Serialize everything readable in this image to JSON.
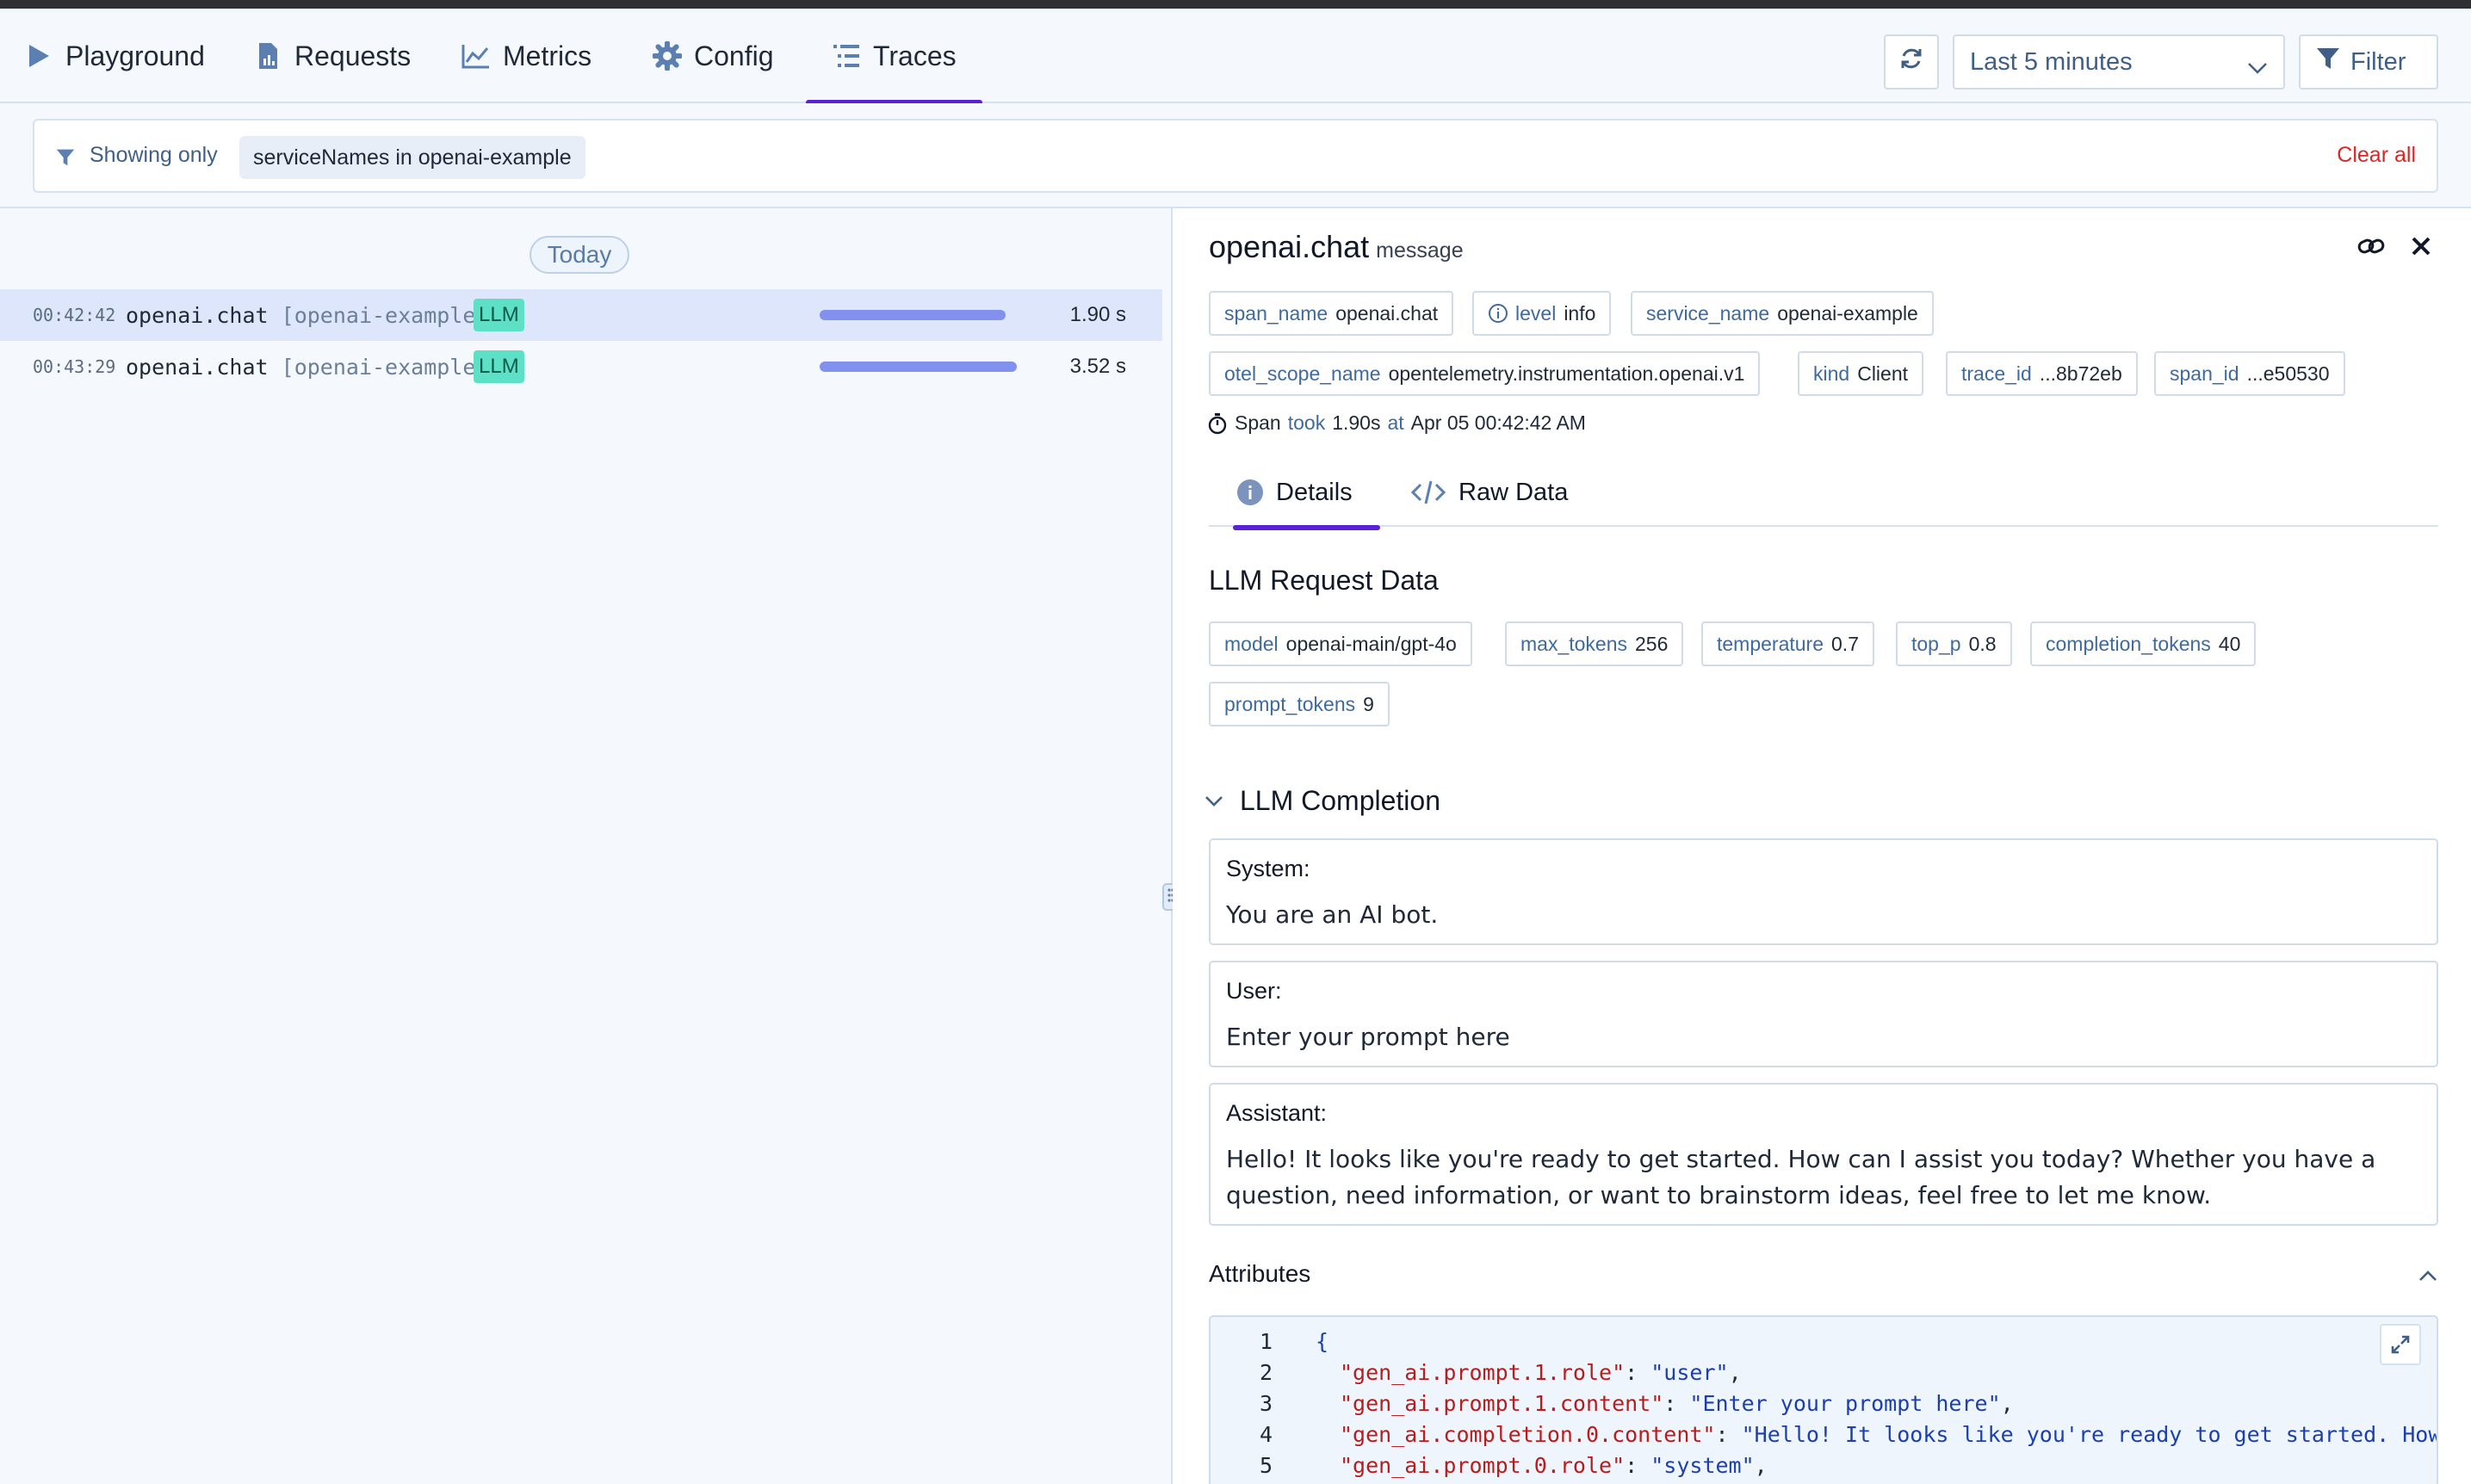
{
  "nav": {
    "tabs": [
      {
        "label": "Playground",
        "icon": "play-icon"
      },
      {
        "label": "Requests",
        "icon": "report-icon"
      },
      {
        "label": "Metrics",
        "icon": "chart-line-icon"
      },
      {
        "label": "Config",
        "icon": "gear-icon"
      },
      {
        "label": "Traces",
        "icon": "list-tree-icon",
        "active": true
      }
    ],
    "time_range": "Last 5 minutes",
    "filter_label": "Filter",
    "accent": "#5b21d6"
  },
  "filter_bar": {
    "label": "Showing only",
    "chip": "serviceNames in openai-example",
    "clear": "Clear all"
  },
  "traces": {
    "group_label": "Today",
    "rows": [
      {
        "time": "00:42:42",
        "name": "openai.chat",
        "service": "[openai-example]",
        "badge": "LLM",
        "duration": "1.90 s",
        "duration_fraction": 0.49,
        "selected": true
      },
      {
        "time": "00:43:29",
        "name": "openai.chat",
        "service": "[openai-example]",
        "badge": "LLM",
        "duration": "3.52 s",
        "duration_fraction": 0.52,
        "selected": false
      }
    ]
  },
  "detail": {
    "title": "openai.chat",
    "kind": "message",
    "tags_row1": [
      {
        "k": "span_name",
        "v": "openai.chat"
      },
      {
        "k": "level",
        "v": "info",
        "icon": "info-icon"
      },
      {
        "k": "service_name",
        "v": "openai-example"
      }
    ],
    "tags_row2": [
      {
        "k": "otel_scope_name",
        "v": "opentelemetry.instrumentation.openai.v1"
      },
      {
        "k": "kind",
        "v": "Client"
      },
      {
        "k": "trace_id",
        "v": "...8b72eb"
      },
      {
        "k": "span_id",
        "v": "...e50530"
      }
    ],
    "took": {
      "prefix": "Span",
      "took_word": "took",
      "value": "1.90s",
      "at_word": "at",
      "when": "Apr 05 00:42:42 AM"
    },
    "tabs": [
      {
        "label": "Details",
        "active": true
      },
      {
        "label": "Raw Data"
      }
    ],
    "request_heading": "LLM Request Data",
    "request_tags_row1": [
      {
        "k": "model",
        "v": "openai-main/gpt-4o"
      },
      {
        "k": "max_tokens",
        "v": "256"
      },
      {
        "k": "temperature",
        "v": "0.7"
      },
      {
        "k": "top_p",
        "v": "0.8"
      },
      {
        "k": "completion_tokens",
        "v": "40"
      }
    ],
    "request_tags_row2": [
      {
        "k": "prompt_tokens",
        "v": "9"
      }
    ],
    "completion_heading": "LLM Completion",
    "messages": [
      {
        "role": "System:",
        "text": "You are an AI bot."
      },
      {
        "role": "User:",
        "text": "Enter your prompt here"
      },
      {
        "role": "Assistant:",
        "text": "Hello! It looks like you're ready to get started. How can I assist you today? Whether you have a question, need information, or want to brainstorm ideas, feel free to let me know."
      }
    ],
    "attributes_heading": "Attributes",
    "code_lines": [
      {
        "n": "1",
        "key": "",
        "val": "",
        "raw": "{"
      },
      {
        "n": "2",
        "key": "\"gen_ai.prompt.1.role\"",
        "val": "\"user\"",
        "raw": ""
      },
      {
        "n": "3",
        "key": "\"gen_ai.prompt.1.content\"",
        "val": "\"Enter your prompt here\"",
        "raw": ""
      },
      {
        "n": "4",
        "key": "\"gen_ai.completion.0.content\"",
        "val": "\"Hello! It looks like you're ready to get started. How can I assist you today?",
        "raw": ""
      },
      {
        "n": "5",
        "key": "\"gen_ai.prompt.0.role\"",
        "val": "\"system\"",
        "raw": ""
      }
    ]
  }
}
